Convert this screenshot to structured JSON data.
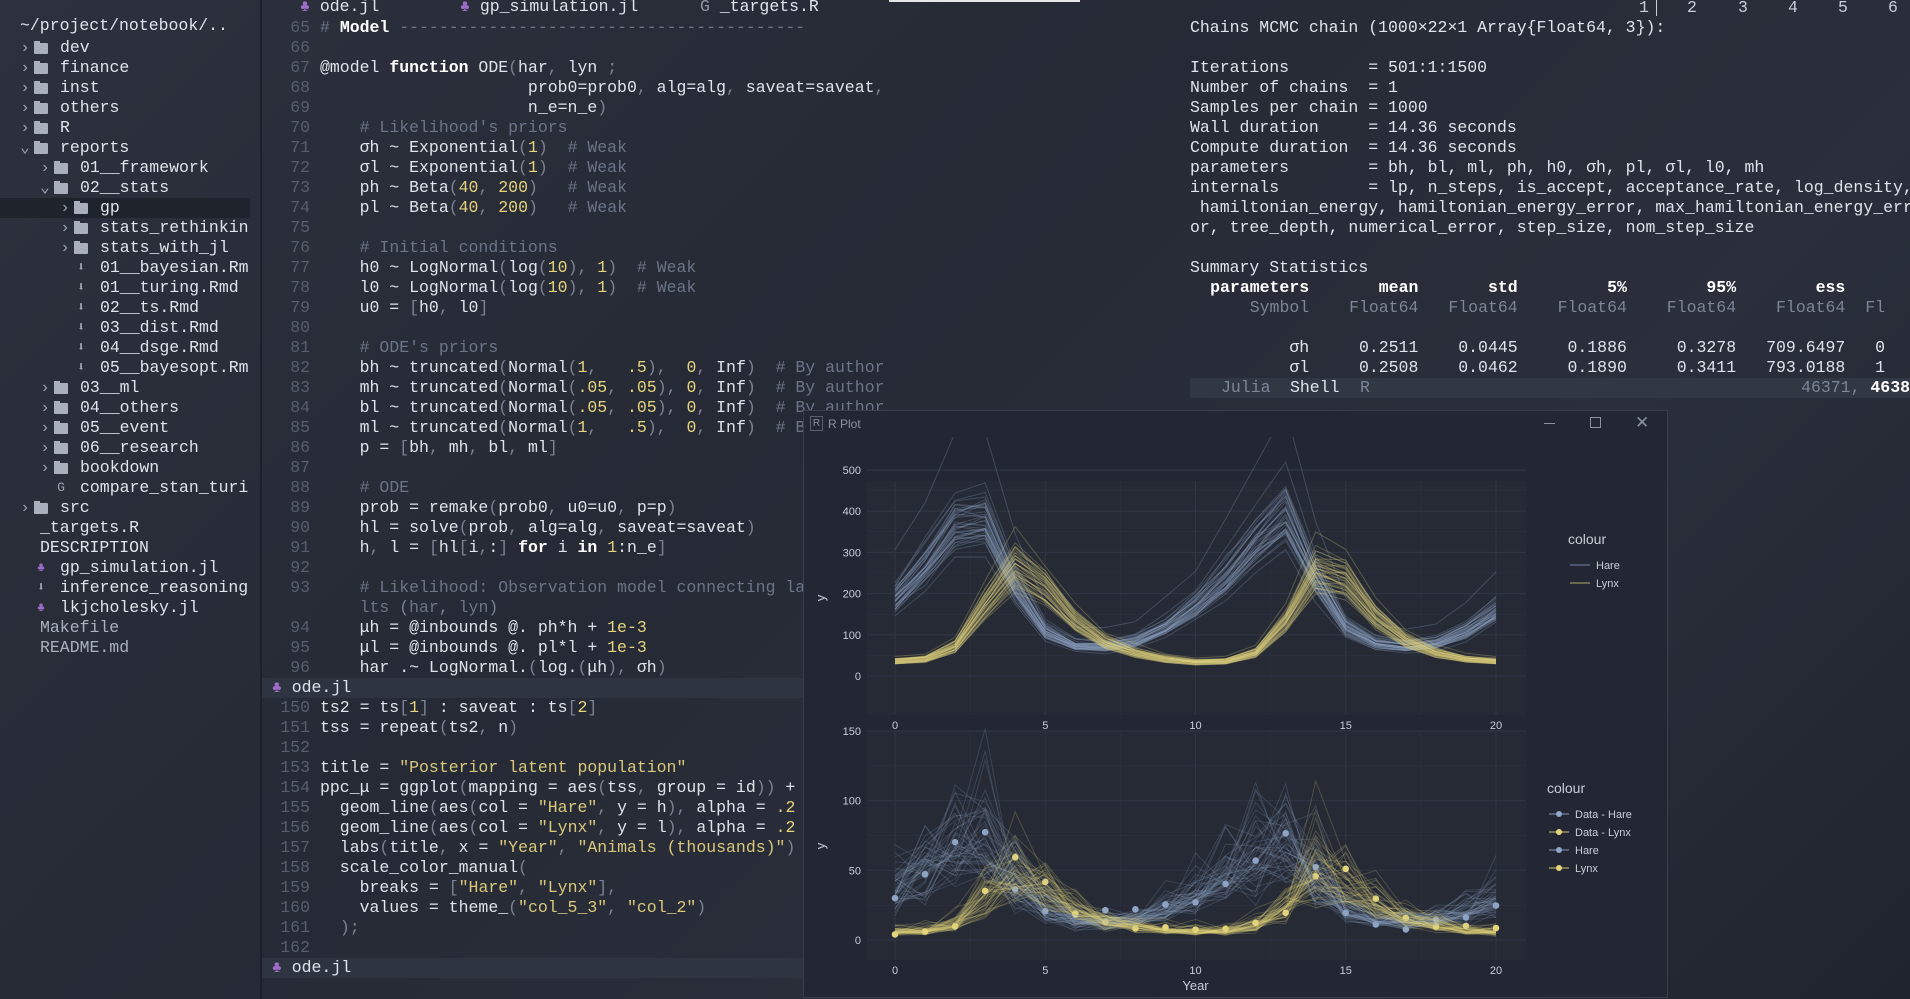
{
  "sidebar": {
    "path": "~/project/notebook/..",
    "items": [
      {
        "label": "dev",
        "level": 0,
        "type": "folder",
        "state": "closed"
      },
      {
        "label": "finance",
        "level": 0,
        "type": "folder",
        "state": "closed"
      },
      {
        "label": "inst",
        "level": 0,
        "type": "folder",
        "state": "closed"
      },
      {
        "label": "others",
        "level": 0,
        "type": "folder",
        "state": "closed"
      },
      {
        "label": "R",
        "level": 0,
        "type": "folder",
        "state": "closed"
      },
      {
        "label": "reports",
        "level": 0,
        "type": "folder",
        "state": "open"
      },
      {
        "label": "01__framework",
        "level": 1,
        "type": "folder",
        "state": "closed"
      },
      {
        "label": "02__stats",
        "level": 1,
        "type": "folder",
        "state": "open"
      },
      {
        "label": "gp",
        "level": 2,
        "type": "folder",
        "state": "closed",
        "selected": true
      },
      {
        "label": "stats_rethinkin",
        "level": 2,
        "type": "folder",
        "state": "closed"
      },
      {
        "label": "stats_with_jl",
        "level": 2,
        "type": "folder",
        "state": "closed"
      },
      {
        "label": "01__bayesian.Rm",
        "level": 2,
        "type": "markdown"
      },
      {
        "label": "01__turing.Rmd",
        "level": 2,
        "type": "markdown"
      },
      {
        "label": "02__ts.Rmd",
        "level": 2,
        "type": "markdown"
      },
      {
        "label": "03__dist.Rmd",
        "level": 2,
        "type": "markdown"
      },
      {
        "label": "04__dsge.Rmd",
        "level": 2,
        "type": "markdown"
      },
      {
        "label": "05__bayesopt.Rm",
        "level": 2,
        "type": "markdown"
      },
      {
        "label": "03__ml",
        "level": 1,
        "type": "folder",
        "state": "closed"
      },
      {
        "label": "04__others",
        "level": 1,
        "type": "folder",
        "state": "closed"
      },
      {
        "label": "05__event",
        "level": 1,
        "type": "folder",
        "state": "closed"
      },
      {
        "label": "06__research",
        "level": 1,
        "type": "folder",
        "state": "closed"
      },
      {
        "label": "bookdown",
        "level": 1,
        "type": "folder",
        "state": "closed"
      },
      {
        "label": "compare_stan_turi",
        "level": 1,
        "type": "r"
      },
      {
        "label": "src",
        "level": 0,
        "type": "folder",
        "state": "closed"
      },
      {
        "label": "_targets.R",
        "level": 0,
        "type": "plain"
      },
      {
        "label": "DESCRIPTION",
        "level": 0,
        "type": "plain"
      },
      {
        "label": "gp_simulation.jl",
        "level": 0,
        "type": "julia"
      },
      {
        "label": "inference_reasoning",
        "level": 0,
        "type": "markdown"
      },
      {
        "label": "lkjcholesky.jl",
        "level": 0,
        "type": "julia"
      },
      {
        "label": "Makefile",
        "level": 0,
        "type": "plain-dim"
      },
      {
        "label": "README.md",
        "level": 0,
        "type": "plain-dim"
      }
    ]
  },
  "tabs": [
    {
      "label": "ode.jl",
      "icon": "julia-icon"
    },
    {
      "label": "gp_simulation.jl",
      "icon": "julia-icon"
    },
    {
      "label": "_targets.R",
      "icon": "r-icon"
    }
  ],
  "editor_top": {
    "lines": [
      {
        "n": "65",
        "text": "# Model -----------------------------------------"
      },
      {
        "n": "66",
        "text": ""
      },
      {
        "n": "67",
        "text": "@model function ODE(har, lyn ;"
      },
      {
        "n": "68",
        "text": "                     prob0=prob0, alg=alg, saveat=saveat,"
      },
      {
        "n": "69",
        "text": "                     n_e=n_e)"
      },
      {
        "n": "70",
        "text": "    # Likelihood's priors"
      },
      {
        "n": "71",
        "text": "    σh ~ Exponential(1)  # Weak"
      },
      {
        "n": "72",
        "text": "    σl ~ Exponential(1)  # Weak"
      },
      {
        "n": "73",
        "text": "    ph ~ Beta(40, 200)   # Weak"
      },
      {
        "n": "74",
        "text": "    pl ~ Beta(40, 200)   # Weak"
      },
      {
        "n": "75",
        "text": ""
      },
      {
        "n": "76",
        "text": "    # Initial conditions"
      },
      {
        "n": "77",
        "text": "    h0 ~ LogNormal(log(10), 1)  # Weak"
      },
      {
        "n": "78",
        "text": "    l0 ~ LogNormal(log(10), 1)  # Weak"
      },
      {
        "n": "79",
        "text": "    u0 = [h0, l0]"
      },
      {
        "n": "80",
        "text": ""
      },
      {
        "n": "81",
        "text": "    # ODE's priors"
      },
      {
        "n": "82",
        "text": "    bh ~ truncated(Normal(1,   .5),  0, Inf)  # By author"
      },
      {
        "n": "83",
        "text": "    mh ~ truncated(Normal(.05, .05), 0, Inf)  # By author"
      },
      {
        "n": "84",
        "text": "    bl ~ truncated(Normal(.05, .05), 0, Inf)  # By author"
      },
      {
        "n": "85",
        "text": "    ml ~ truncated(Normal(1,   .5),  0, Inf)  # By author"
      },
      {
        "n": "86",
        "text": "    p = [bh, mh, bl, ml]"
      },
      {
        "n": "87",
        "text": ""
      },
      {
        "n": "88",
        "text": "    # ODE"
      },
      {
        "n": "89",
        "text": "    prob = remake(prob0, u0=u0, p=p)"
      },
      {
        "n": "90",
        "text": "    hl = solve(prob, alg=alg, saveat=saveat)"
      },
      {
        "n": "91",
        "text": "    h, l = [hl[i,:] for i in 1:n_e]"
      },
      {
        "n": "92",
        "text": ""
      },
      {
        "n": "93",
        "text": "    # Likelihood: Observation model connecting la"
      },
      {
        "n": "",
        "text": "    # lts (har, lyn)"
      },
      {
        "n": "94",
        "text": "    μh = @inbounds @. ph*h + 1e-3"
      },
      {
        "n": "95",
        "text": "    μl = @inbounds @. pl*l + 1e-3"
      },
      {
        "n": "96",
        "text": "    har .~ LogNormal.(log.(μh), σh)"
      }
    ],
    "status_file": "ode.jl"
  },
  "editor_bottom": {
    "lines": [
      {
        "n": "150",
        "text": "ts2 = ts[1] : saveat : ts[2]"
      },
      {
        "n": "151",
        "text": "tss = repeat(ts2, n)"
      },
      {
        "n": "152",
        "text": ""
      },
      {
        "n": "153",
        "text": "title = \"Posterior latent population\""
      },
      {
        "n": "154",
        "text": "ppc_μ = ggplot(mapping = aes(tss, group = id)) +"
      },
      {
        "n": "155",
        "text": "  geom_line(aes(col = \"Hare\", y = h), alpha = .2"
      },
      {
        "n": "156",
        "text": "  geom_line(aes(col = \"Lynx\", y = l), alpha = .2"
      },
      {
        "n": "157",
        "text": "  labs(title, x = \"Year\", \"Animals (thousands)\")"
      },
      {
        "n": "158",
        "text": "  scale_color_manual("
      },
      {
        "n": "159",
        "text": "    breaks = [\"Hare\", \"Lynx\"],"
      },
      {
        "n": "160",
        "text": "    values = theme_(\"col_5_3\", \"col_2\")"
      },
      {
        "n": "161",
        "text": "  );"
      },
      {
        "n": "162",
        "text": ""
      }
    ],
    "status_file": "ode.jl"
  },
  "workspaces": [
    "1",
    "2",
    "3",
    "4",
    "5",
    "6"
  ],
  "terminal": {
    "header": "Chains MCMC chain (1000×22×1 Array{Float64, 3}):",
    "info": [
      "Iterations        = 501:1:1500",
      "Number of chains  = 1",
      "Samples per chain = 1000",
      "Wall duration     = 14.36 seconds",
      "Compute duration  = 14.36 seconds",
      "parameters        = bh, bl, ml, ph, h0, σh, pl, σl, l0, mh",
      "internals         = lp, n_steps, is_accept, acceptance_rate, log_density,",
      " hamiltonian_energy, hamiltonian_energy_error, max_hamiltonian_energy_err",
      "or, tree_depth, numerical_error, step_size, nom_step_size"
    ],
    "summary_title": "Summary Statistics",
    "columns": [
      "parameters",
      "mean",
      "std",
      "5%",
      "95%",
      "ess",
      ""
    ],
    "types": [
      "Symbol",
      "Float64",
      "Float64",
      "Float64",
      "Float64",
      "Float64",
      "Fl"
    ],
    "rows": [
      [
        "σh",
        "0.2511",
        "0.0445",
        "0.1886",
        "0.3278",
        "709.6497",
        "0"
      ],
      [
        "σl",
        "0.2508",
        "0.0462",
        "0.1890",
        "0.3411",
        "793.0188",
        "1"
      ]
    ],
    "shell_tabs": [
      "Julia",
      "Shell",
      "R"
    ],
    "position_a": "46371,",
    "position_b": "4638"
  },
  "plot_window": {
    "title": "R Plot",
    "icon_label": "R",
    "controls": [
      "minimize",
      "maximize",
      "close"
    ]
  },
  "colors": {
    "hare": "#8fa5c6",
    "lynx": "#e4d57c",
    "panel": "#252a35",
    "grid": "#303543"
  },
  "chart_data": [
    {
      "type": "line",
      "xlabel": "Year",
      "ylabel": "y",
      "xlim": [
        0,
        20
      ],
      "ylim": [
        0,
        500
      ],
      "xticks": [
        0,
        5,
        10,
        15,
        20
      ],
      "yticks": [
        0,
        100,
        200,
        300,
        400,
        500
      ],
      "grid": true,
      "legend_title": "colour",
      "legend_position": "right",
      "x": [
        0,
        1,
        2,
        3,
        4,
        5,
        6,
        7,
        8,
        9,
        10,
        11,
        12,
        13,
        14,
        15,
        16,
        17,
        18,
        19,
        20
      ],
      "series": [
        {
          "name": "Hare",
          "values": [
            190,
            270,
            370,
            380,
            220,
            110,
            75,
            72,
            85,
            120,
            170,
            240,
            330,
            400,
            240,
            120,
            80,
            72,
            80,
            110,
            160
          ]
        },
        {
          "name": "Lynx",
          "values": [
            35,
            40,
            70,
            170,
            260,
            210,
            130,
            80,
            55,
            40,
            33,
            35,
            55,
            130,
            250,
            230,
            140,
            85,
            55,
            40,
            35
          ]
        }
      ]
    },
    {
      "type": "line",
      "xlabel": "Year",
      "ylabel": "y",
      "xlim": [
        0,
        20
      ],
      "ylim": [
        0,
        150
      ],
      "xticks": [
        0,
        5,
        10,
        15,
        20
      ],
      "yticks": [
        0,
        50,
        100,
        150
      ],
      "grid": true,
      "legend_title": "colour",
      "legend_position": "right",
      "x": [
        0,
        1,
        2,
        3,
        4,
        5,
        6,
        7,
        8,
        9,
        10,
        11,
        12,
        13,
        14,
        15,
        16,
        17,
        18,
        19,
        20
      ],
      "series": [
        {
          "name": "Data - Hare",
          "kind": "points",
          "values": [
            30,
            47.2,
            70.2,
            77.4,
            36.3,
            20.6,
            18.1,
            21.4,
            22,
            25.4,
            27.1,
            40.3,
            57,
            76.6,
            52.3,
            19.5,
            11.2,
            7.6,
            14.6,
            16.2,
            24.7
          ]
        },
        {
          "name": "Data - Lynx",
          "kind": "points",
          "values": [
            4,
            6.1,
            9.8,
            35.2,
            59.4,
            41.7,
            19,
            13,
            8.3,
            9.1,
            7.4,
            8,
            12.3,
            19.5,
            45.7,
            51.1,
            29.7,
            15.8,
            9.7,
            10.1,
            8.6
          ]
        },
        {
          "name": "Hare",
          "kind": "lines",
          "values": [
            35,
            50,
            67,
            69,
            40,
            20,
            14,
            13,
            15,
            21,
            31,
            44,
            60,
            72,
            44,
            22,
            14,
            13,
            15,
            20,
            29
          ]
        },
        {
          "name": "Lynx",
          "kind": "lines",
          "values": [
            6,
            7,
            12,
            30,
            47,
            38,
            23,
            14,
            10,
            7,
            6,
            6,
            10,
            23,
            45,
            41,
            25,
            15,
            10,
            7,
            6
          ]
        }
      ]
    }
  ]
}
